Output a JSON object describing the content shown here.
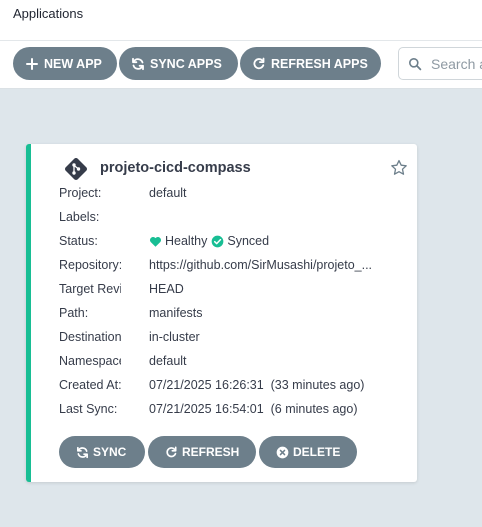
{
  "header": {
    "title": "Applications"
  },
  "toolbar": {
    "new_app": "NEW APP",
    "sync_apps": "SYNC APPS",
    "refresh_apps": "REFRESH APPS",
    "search_placeholder": "Search a"
  },
  "app": {
    "name": "projeto-cicd-compass",
    "fields": {
      "project": {
        "label": "Project:",
        "value": "default"
      },
      "labels": {
        "label": "Labels:",
        "value": ""
      },
      "status": {
        "label": "Status:",
        "health": "Healthy",
        "sync": "Synced"
      },
      "repository": {
        "label": "Repository:",
        "value": "https://github.com/SirMusashi/projeto_..."
      },
      "target_revision": {
        "label": "Target Revision:",
        "value": "HEAD"
      },
      "path": {
        "label": "Path:",
        "value": "manifests"
      },
      "destination": {
        "label": "Destination:",
        "value": "in-cluster"
      },
      "namespace": {
        "label": "Namespace:",
        "value": "default"
      },
      "created_at": {
        "label": "Created At:",
        "value": "07/21/2025 16:26:31  (33 minutes ago)"
      },
      "last_sync": {
        "label": "Last Sync:",
        "value": "07/21/2025 16:54:01  (6 minutes ago)"
      }
    },
    "actions": {
      "sync": "SYNC",
      "refresh": "REFRESH",
      "delete": "DELETE"
    }
  },
  "colors": {
    "accent": "#18be94",
    "button": "#6d7f8b",
    "background": "#dee6eb"
  },
  "icons": {
    "new_app": "plus-icon",
    "sync": "sync-icon",
    "refresh": "redo-icon",
    "search": "search-icon",
    "app": "git-logo-icon",
    "favorite": "star-icon",
    "healthy": "heart-icon",
    "synced": "check-circle-icon",
    "delete": "times-circle-icon"
  }
}
